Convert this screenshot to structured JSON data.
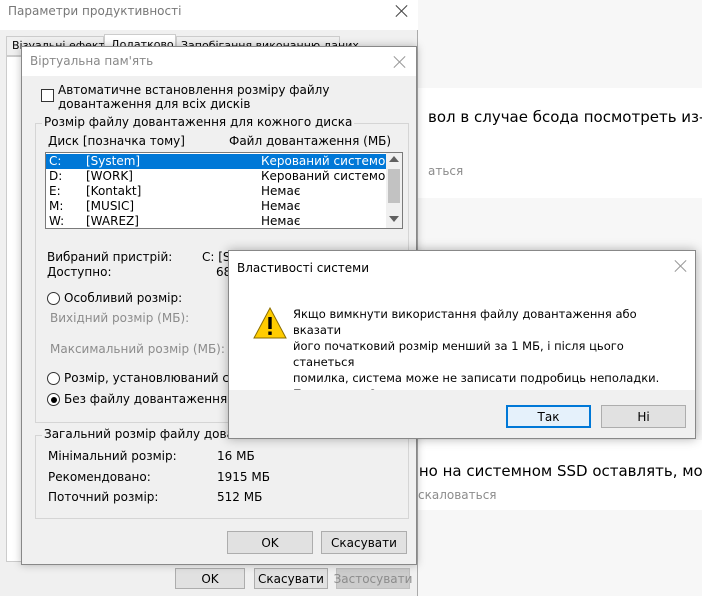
{
  "background_page": {
    "line1": "вол в случае бсода посмотреть из-за",
    "line1_sub": "аться",
    "line2": "ьно на системном SSD оставлять, мож",
    "line2_sub": "скаловаться"
  },
  "perf_window": {
    "title": "Параметри продуктивності",
    "tabs": [
      "Візуальні ефекти",
      "Додатково",
      "Запобігання виконанню даних"
    ],
    "ok_label": "OK",
    "cancel_label": "Скасувати",
    "apply_label": "Застосувати"
  },
  "vm_dialog": {
    "title": "Віртуальна пам'ять",
    "auto_manage_label": "Автоматичне встановлення розміру файлу довантаження для всіх дисків",
    "per_drive_group_label": "Розмір файлу довантаження для кожного диска",
    "col_drive": "Диск [позначка тому]",
    "col_pagefile": "Файл довантаження (МБ)",
    "drives": [
      {
        "letter": "C:",
        "label": "[System]",
        "size": "Керований системою",
        "selected": true
      },
      {
        "letter": "D:",
        "label": "[WORK]",
        "size": "Керований системою",
        "selected": false
      },
      {
        "letter": "E:",
        "label": "[Kontakt]",
        "size": "Немає",
        "selected": false
      },
      {
        "letter": "M:",
        "label": "[MUSIC]",
        "size": "Немає",
        "selected": false
      },
      {
        "letter": "W:",
        "label": "[WAREZ]",
        "size": "Немає",
        "selected": false
      }
    ],
    "selected_drive_label": "Вибраний пристрій:",
    "selected_drive_value": "C:  [S",
    "available_label": "Доступно:",
    "available_value": "68",
    "custom_size_label": "Особливий розмір:",
    "initial_size_label": "Вихідний розмір (МБ):",
    "max_size_label": "Максимальний розмір (МБ):",
    "system_managed_label": "Розмір, установлюваний сист",
    "no_paging_label": "Без файлу довантаження",
    "total_group_label": "Загальний розмір файлу довантаж",
    "min_label": "Мінімальний розмір:",
    "min_value": "16 МБ",
    "recommended_label": "Рекомендовано:",
    "recommended_value": "1915 МБ",
    "current_label": "Поточний розмір:",
    "current_value": "512 МБ",
    "ok_label": "OK",
    "cancel_label": "Скасувати"
  },
  "sys_dialog": {
    "title": "Властивості системи",
    "message_lines": [
      "Якщо вимкнути використання файлу довантаження або вказати",
      "його початковий розмір менший за 1 МБ, і після цього станеться",
      "помилка, система може не записати подробиць неполадки.",
      "Продовжити?"
    ],
    "yes_label": "Так",
    "no_label": "Ні"
  },
  "colors": {
    "accent": "#0078d7",
    "warning": "#ffcc00"
  }
}
